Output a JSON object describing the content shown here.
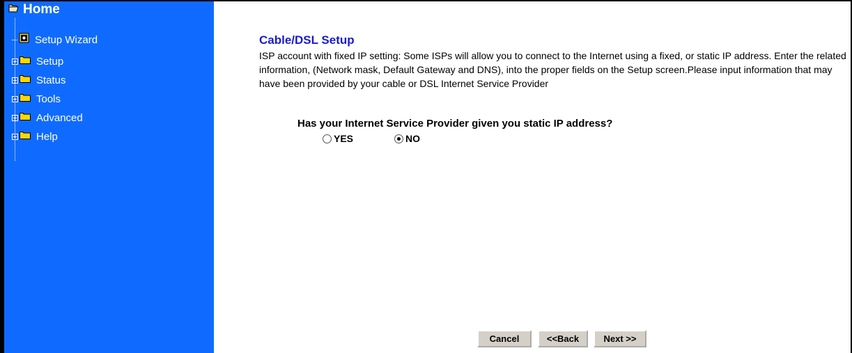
{
  "sidebar": {
    "home": {
      "label": "Home",
      "icon": "open-folder-icon"
    },
    "items": [
      {
        "label": "Setup Wizard",
        "icon": "wizard-page-icon",
        "expandable": false
      },
      {
        "label": "Setup",
        "icon": "folder-icon",
        "expandable": true
      },
      {
        "label": "Status",
        "icon": "folder-icon",
        "expandable": true
      },
      {
        "label": "Tools",
        "icon": "folder-icon",
        "expandable": true
      },
      {
        "label": "Advanced",
        "icon": "folder-icon",
        "expandable": true
      },
      {
        "label": "Help",
        "icon": "folder-icon",
        "expandable": true
      }
    ],
    "bg_color": "#0f6bff"
  },
  "main": {
    "title": "Cable/DSL Setup",
    "description": "ISP account with fixed IP setting: Some ISPs will allow you to connect to the Internet using a fixed, or static IP address. Enter the related information, (Network mask, Default Gateway and DNS), into the proper fields on the Setup screen.Please input information that may have been provided by your cable or DSL Internet Service Provider",
    "question": "Has your Internet Service Provider given you static IP address?",
    "options": [
      {
        "label": "YES",
        "selected": false
      },
      {
        "label": "NO",
        "selected": true
      }
    ]
  },
  "buttons": {
    "cancel": "Cancel",
    "back": "<<Back",
    "next": "Next >>"
  }
}
